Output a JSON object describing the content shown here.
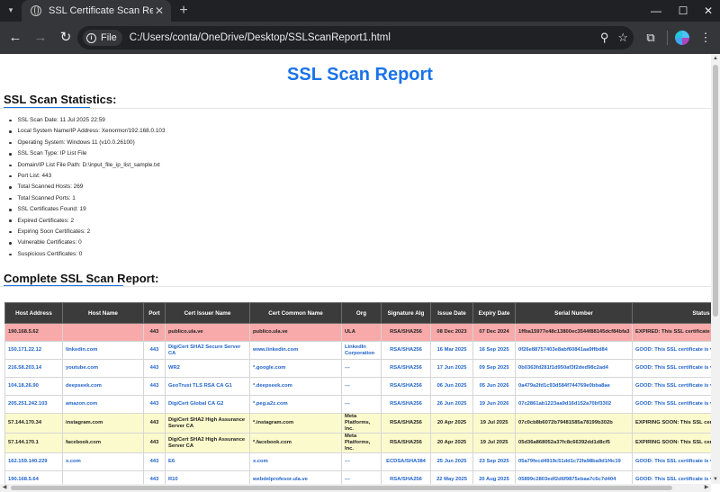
{
  "browser": {
    "tab_title": "SSL Certificate Scan Report by N",
    "omnibox_chip": "File",
    "url": "C:/Users/conta/OneDrive/Desktop/SSLScanReport1.html"
  },
  "page": {
    "title": "SSL Scan Report",
    "stats_heading": "SSL Scan Statistics:",
    "report_heading": "Complete SSL Scan Report:",
    "stats": [
      "SSL Scan Date: 11 Jul 2025 22:59",
      "Local System Name/IP Address: Xenormor/192.168.0.103",
      "Operating System: Windows 11 (v10.0.26100)",
      "SSL Scan Type: IP List File",
      "Domain/IP List File Path: D:\\input_file_ip_list_sample.txt",
      "Port List: 443",
      "Total Scanned Hosts: 269",
      "Total Scanned Ports: 1",
      "SSL Certificates Found: 19",
      "Expired Certificates: 2",
      "Expiring Soon Certificates: 2",
      "Vulnerable Certificates: 0",
      "Suspicious Certificates: 0"
    ]
  },
  "table": {
    "headers": [
      "Host Address",
      "Host Name",
      "Port",
      "Cert Issuer Name",
      "Cert Common Name",
      "Org",
      "Signature Alg",
      "Issue Date",
      "Expiry Date",
      "Serial Number",
      "Status"
    ],
    "rows": [
      {
        "status_class": "expired",
        "cells": [
          "190.168.5.62",
          "",
          "443",
          "publico.ula.ve",
          "publico.ula.ve",
          "ULA",
          "RSA/SHA256",
          "08 Dec 2023",
          "07 Dec 2024",
          "1ffba15977e48c13800ec3544f88145dcf84bfa3",
          "EXPIRED: This SSL certificate"
        ]
      },
      {
        "status_class": "good",
        "cells": [
          "150.171.22.12",
          "linkedin.com",
          "443",
          "DigiCert SHA2 Secure Server CA",
          "www.linkedin.com",
          "LinkedIn Corporation",
          "RSA/SHA256",
          "16 Mar 2025",
          "16 Sep 2025",
          "0f26e88757403e8abf60841aa9ffbd84",
          "GOOD: This SSL certificate is v"
        ]
      },
      {
        "status_class": "good",
        "cells": [
          "216.58.203.14",
          "youtube.com",
          "443",
          "WR2",
          "*.google.com",
          "---",
          "RSA/SHA256",
          "17 Jun 2025",
          "09 Sep 2025",
          "0b0363fd281f1d950af3f2ded98c2ad4",
          "GOOD: This SSL certificate is v"
        ]
      },
      {
        "status_class": "good",
        "cells": [
          "104.18.26.90",
          "deepseek.com",
          "443",
          "GeoTrust TLS RSA CA G1",
          "*.deepseek.com",
          "---",
          "RSA/SHA256",
          "06 Jun 2025",
          "05 Jun 2026",
          "0a479a2fd1c93d584f744769e0bba8ae",
          "GOOD: This SSL certificate is v"
        ]
      },
      {
        "status_class": "good",
        "cells": [
          "205.251.242.103",
          "amazon.com",
          "443",
          "DigiCert Global CA G2",
          "*.peg.a2z.com",
          "---",
          "RSA/SHA256",
          "26 Jun 2025",
          "19 Jun 2026",
          "07c2861ab1223aa9d16d152a70bf3302",
          "GOOD: This SSL certificate is v"
        ]
      },
      {
        "status_class": "soon",
        "cells": [
          "57.144.170.34",
          "instagram.com",
          "443",
          "DigiCert SHA2 High Assurance Server CA",
          "*.instagram.com",
          "Meta Platforms, Inc.",
          "RSA/SHA256",
          "20 Apr 2025",
          "19 Jul 2025",
          "07c0cb8b6072b79481585a78199b302b",
          "EXPIRING SOON: This SSL cert"
        ]
      },
      {
        "status_class": "soon",
        "cells": [
          "57.144.170.1",
          "facebook.com",
          "443",
          "DigiCert SHA2 High Assurance Server CA",
          "*.facebook.com",
          "Meta Platforms, Inc.",
          "RSA/SHA256",
          "20 Apr 2025",
          "19 Jul 2025",
          "05d36a868052a37fc8c66392dd1d8cf5",
          "EXPIRING SOON: This SSL cert"
        ]
      },
      {
        "status_class": "good",
        "cells": [
          "162.159.140.229",
          "x.com",
          "443",
          "E6",
          "x.com",
          "---",
          "ECDSA/SHA384",
          "25 Jun 2025",
          "23 Sep 2025",
          "05a79fecd4919c51dd1c72fa98ba9d1f4c19",
          "GOOD: This SSL certificate is v"
        ]
      },
      {
        "status_class": "good",
        "cells": [
          "190.168.5.64",
          "",
          "443",
          "R10",
          "webdelprofesor.ula.ve",
          "---",
          "RSA/SHA256",
          "22 May 2025",
          "20 Aug 2025",
          "05899c2803edf2d6f9875ebaa7c6c7d404",
          "GOOD: This SSL certificate is v"
        ]
      }
    ]
  }
}
